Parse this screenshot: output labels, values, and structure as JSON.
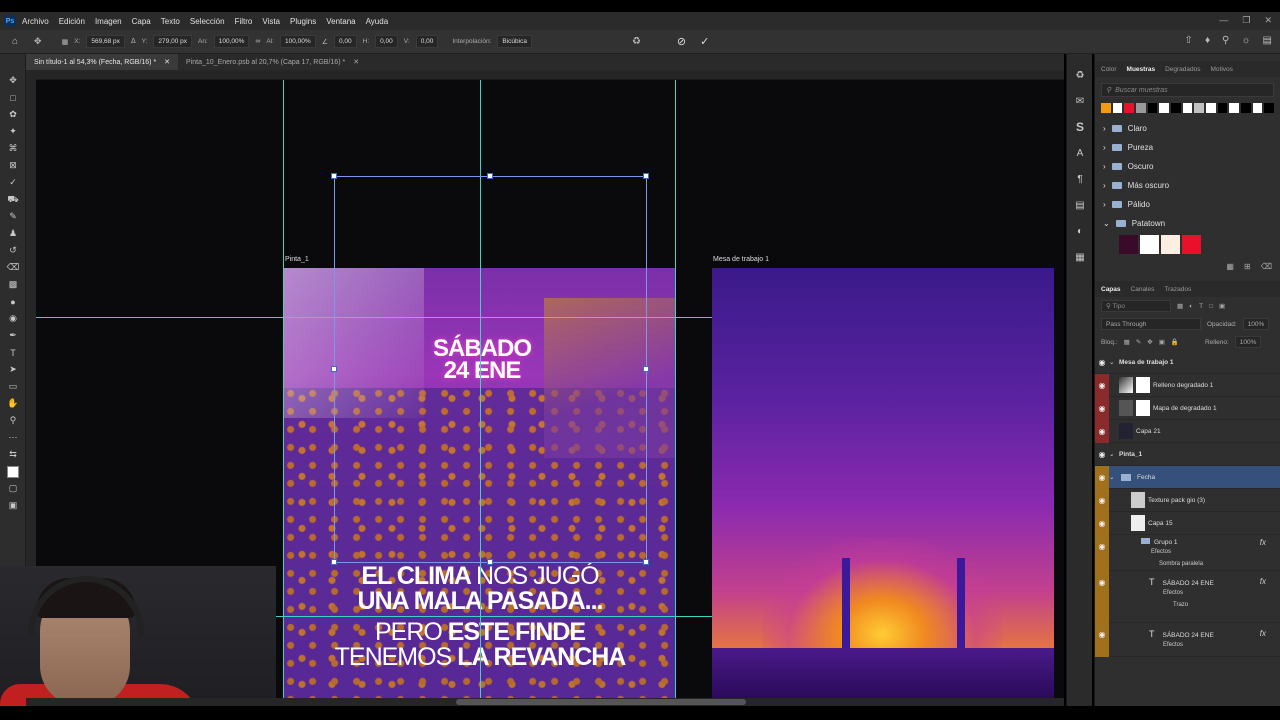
{
  "app": {
    "logo": "Ps"
  },
  "menu": [
    "Archivo",
    "Edición",
    "Imagen",
    "Capa",
    "Texto",
    "Selección",
    "Filtro",
    "Vista",
    "Plugins",
    "Ventana",
    "Ayuda"
  ],
  "options": {
    "x_label": "X:",
    "x_value": "569,68 px",
    "y_label": "Y:",
    "y_value": "279,00 px",
    "w_label": "An:",
    "w_value": "100,00%",
    "h_label": "Al:",
    "h_value": "100,00%",
    "angle_value": "0,00",
    "hskew_label": "H:",
    "hskew_value": "0,00",
    "vskew_label": "V:",
    "vskew_value": "0,00",
    "interp_label": "Interpolación:",
    "interp_value": "Bicúbica"
  },
  "tabs": [
    {
      "label": "Sin título-1 al 54,3% (Fecha, RGB/16) *",
      "active": true
    },
    {
      "label": "Pinta_10_Enero.psb al 20,7% (Capa 17, RGB/16) *",
      "active": false
    }
  ],
  "canvas": {
    "artboard1_name": "Pinta_1",
    "artboard2_name": "Mesa de trabajo 1",
    "date_line1": "SÁBADO",
    "date_line2": "24 ENE",
    "headline": {
      "l1a": "EL CLIMA",
      "l1b": "NOS JUGÓ",
      "l2": "UNA MALA PASADA...",
      "l3a": "PERO",
      "l3b": "ESTE FINDE",
      "l4a": "TENEMOS",
      "l4b": "LA REVANCHA"
    }
  },
  "swatches_panel": {
    "tabs": [
      "Color",
      "Muestras",
      "Degradados",
      "Motivos"
    ],
    "active_tab": "Muestras",
    "search_placeholder": "Buscar muestras",
    "colors": [
      "#f39c12",
      "#ffffff",
      "#e8102a",
      "#9a9a9a",
      "#000000",
      "#ffffff",
      "#000000",
      "#ffffff",
      "#c0c0c0",
      "#ffffff",
      "#000000",
      "#ffffff",
      "#000000",
      "#ffffff",
      "#000000"
    ],
    "folders": [
      "Claro",
      "Pureza",
      "Oscuro",
      "Más oscuro",
      "Pálido",
      "Patatown"
    ],
    "patatown_colors": [
      "#3a0a2a",
      "#ffffff",
      "#fdeee2",
      "#e8102a"
    ]
  },
  "layers_panel": {
    "tabs": [
      "Capas",
      "Canales",
      "Trazados"
    ],
    "active_tab": "Capas",
    "filter_placeholder": "Tipo",
    "blend_mode": "Pass Through",
    "opacity_label": "Opacidad:",
    "opacity_value": "100%",
    "lock_label": "Bloq.:",
    "fill_label": "Relleno:",
    "fill_value": "100%",
    "layers": [
      {
        "name": "Mesa de trabajo 1",
        "kind": "artboard"
      },
      {
        "name": "Relleno degradado 1",
        "kind": "layer",
        "tag": "#8a2a2a"
      },
      {
        "name": "Mapa de degradado 1",
        "kind": "layer",
        "tag": "#8a2a2a"
      },
      {
        "name": "Capa 21",
        "kind": "layer",
        "tag": "#8a2a2a"
      },
      {
        "name": "Pinta_1",
        "kind": "artboard"
      },
      {
        "name": "Fecha",
        "kind": "group",
        "tag": "#a0701a",
        "selected": true
      },
      {
        "name": "Texture pack gio (3)",
        "kind": "layer",
        "tag": "#a0701a"
      },
      {
        "name": "Capa 15",
        "kind": "layer",
        "tag": "#a0701a"
      },
      {
        "name": "Grupo 1",
        "kind": "group",
        "tag": "#a0701a",
        "fx": true
      },
      {
        "name": "SÁBADO 24 ENE",
        "kind": "text",
        "tag": "#a0701a",
        "fx": true
      },
      {
        "name": "SÁBADO 24 ENE",
        "kind": "text",
        "tag": "#a0701a",
        "fx": true
      }
    ],
    "effects_label": "Efectos",
    "shadow_label": "Sombra paralela",
    "stroke_label": "Trazo"
  }
}
